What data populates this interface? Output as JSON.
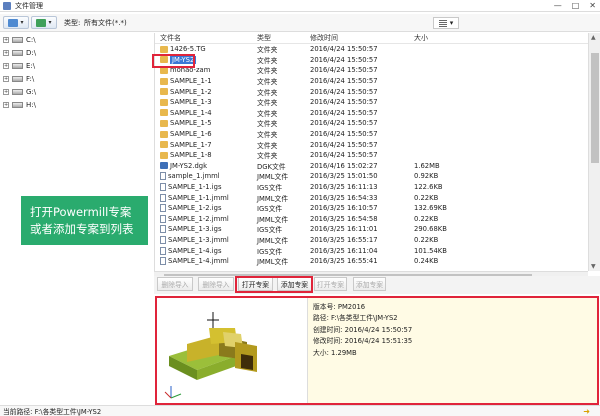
{
  "window": {
    "title": "文件管理",
    "minimize": "—",
    "maximize": "□",
    "close": "✕"
  },
  "toolbar": {
    "type_label": "类型:",
    "type_value": "所有文件(*.*)"
  },
  "tree": {
    "drives": [
      "C:\\",
      "D:\\",
      "E:\\",
      "F:\\",
      "G:\\",
      "H:\\"
    ],
    "expander": "+"
  },
  "list": {
    "headers": {
      "name": "文件名",
      "type": "类型",
      "modified": "修改时间",
      "size": "大小"
    },
    "rows": [
      {
        "icon": "folder",
        "name": "1426-5.TG",
        "type": "文件夹",
        "modified": "2016/4/24 15:50:57",
        "size": ""
      },
      {
        "icon": "folder",
        "name": "JM-YS2",
        "type": "文件夹",
        "modified": "2016/4/24 15:50:57",
        "size": ""
      },
      {
        "icon": "folder",
        "name": "mohao-zam",
        "type": "文件夹",
        "modified": "2016/4/24 15:50:57",
        "size": ""
      },
      {
        "icon": "folder",
        "name": "SAMPLE_1-1",
        "type": "文件夹",
        "modified": "2016/4/24 15:50:57",
        "size": ""
      },
      {
        "icon": "folder",
        "name": "SAMPLE_1-2",
        "type": "文件夹",
        "modified": "2016/4/24 15:50:57",
        "size": ""
      },
      {
        "icon": "folder",
        "name": "SAMPLE_1-3",
        "type": "文件夹",
        "modified": "2016/4/24 15:50:57",
        "size": ""
      },
      {
        "icon": "folder",
        "name": "SAMPLE_1-4",
        "type": "文件夹",
        "modified": "2016/4/24 15:50:57",
        "size": ""
      },
      {
        "icon": "folder",
        "name": "SAMPLE_1-5",
        "type": "文件夹",
        "modified": "2016/4/24 15:50:57",
        "size": ""
      },
      {
        "icon": "folder",
        "name": "SAMPLE_1-6",
        "type": "文件夹",
        "modified": "2016/4/24 15:50:57",
        "size": ""
      },
      {
        "icon": "folder",
        "name": "SAMPLE_1-7",
        "type": "文件夹",
        "modified": "2016/4/24 15:50:57",
        "size": ""
      },
      {
        "icon": "folder",
        "name": "SAMPLE_1-8",
        "type": "文件夹",
        "modified": "2016/4/24 15:50:57",
        "size": ""
      },
      {
        "icon": "dgk",
        "name": "JM-YS2.dgk",
        "type": "DGK文件",
        "modified": "2016/4/16 15:02:27",
        "size": "1.62MB"
      },
      {
        "icon": "file",
        "name": "sample_1.jmml",
        "type": "JMML文件",
        "modified": "2016/3/25 15:01:50",
        "size": "0.92KB"
      },
      {
        "icon": "file",
        "name": "SAMPLE_1-1.igs",
        "type": "IGS文件",
        "modified": "2016/3/25 16:11:13",
        "size": "122.6KB"
      },
      {
        "icon": "file",
        "name": "SAMPLE_1-1.jmml",
        "type": "JMML文件",
        "modified": "2016/3/25 16:54:33",
        "size": "0.22KB"
      },
      {
        "icon": "file",
        "name": "SAMPLE_1-2.igs",
        "type": "IGS文件",
        "modified": "2016/3/25 16:10:57",
        "size": "132.69KB"
      },
      {
        "icon": "file",
        "name": "SAMPLE_1-2.jmml",
        "type": "JMML文件",
        "modified": "2016/3/25 16:54:58",
        "size": "0.22KB"
      },
      {
        "icon": "file",
        "name": "SAMPLE_1-3.igs",
        "type": "IGS文件",
        "modified": "2016/3/25 16:11:01",
        "size": "290.68KB"
      },
      {
        "icon": "file",
        "name": "SAMPLE_1-3.jmml",
        "type": "JMML文件",
        "modified": "2016/3/25 16:55:17",
        "size": "0.22KB"
      },
      {
        "icon": "file",
        "name": "SAMPLE_1-4.igs",
        "type": "IGS文件",
        "modified": "2016/3/25 16:11:04",
        "size": "101.54KB"
      },
      {
        "icon": "file",
        "name": "SAMPLE_1-4.jmml",
        "type": "JMML文件",
        "modified": "2016/3/25 16:55:41",
        "size": "0.24KB"
      }
    ],
    "selected_index": 1
  },
  "buttons": {
    "delete_import": "删除导入",
    "delete_import2": "删除导入",
    "open_project": "打开专案",
    "add_project": "添加专案",
    "disabled_a": "打开专案",
    "disabled_b": "添加专案"
  },
  "banner": {
    "line1": "打开Powermill专案",
    "line2": "或者添加专案到列表"
  },
  "preview": {
    "version": "版本号: PM2016",
    "path": "路径: F:\\各类型工件\\JM-YS2",
    "created": "创建时间: 2016/4/24 15:50:57",
    "modified": "修改时间: 2016/4/24 15:51:35",
    "size": "大小: 1.29MB"
  },
  "status": {
    "path": "当前路径: F:\\各类型工件\\JM-YS2"
  }
}
